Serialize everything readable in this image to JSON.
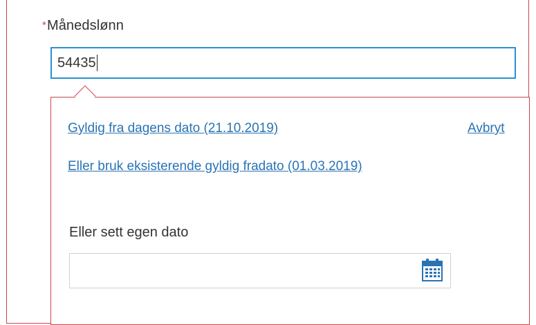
{
  "salary_field": {
    "required_marker": "*",
    "label": "Månedslønn",
    "value": "54435"
  },
  "date_popover": {
    "today_link": "Gyldig fra dagens dato (21.10.2019)",
    "cancel_link": "Avbryt",
    "existing_link": "Eller bruk eksisterende gyldig fradato (01.03.2019)",
    "custom_label": "Eller sett egen dato",
    "custom_date_value": "",
    "calendar_icon": "calendar-icon"
  },
  "colors": {
    "error_border": "#c9444a",
    "focus_border": "#2b8fd0",
    "link": "#2a73b5",
    "calendar_icon": "#2a73b5"
  }
}
